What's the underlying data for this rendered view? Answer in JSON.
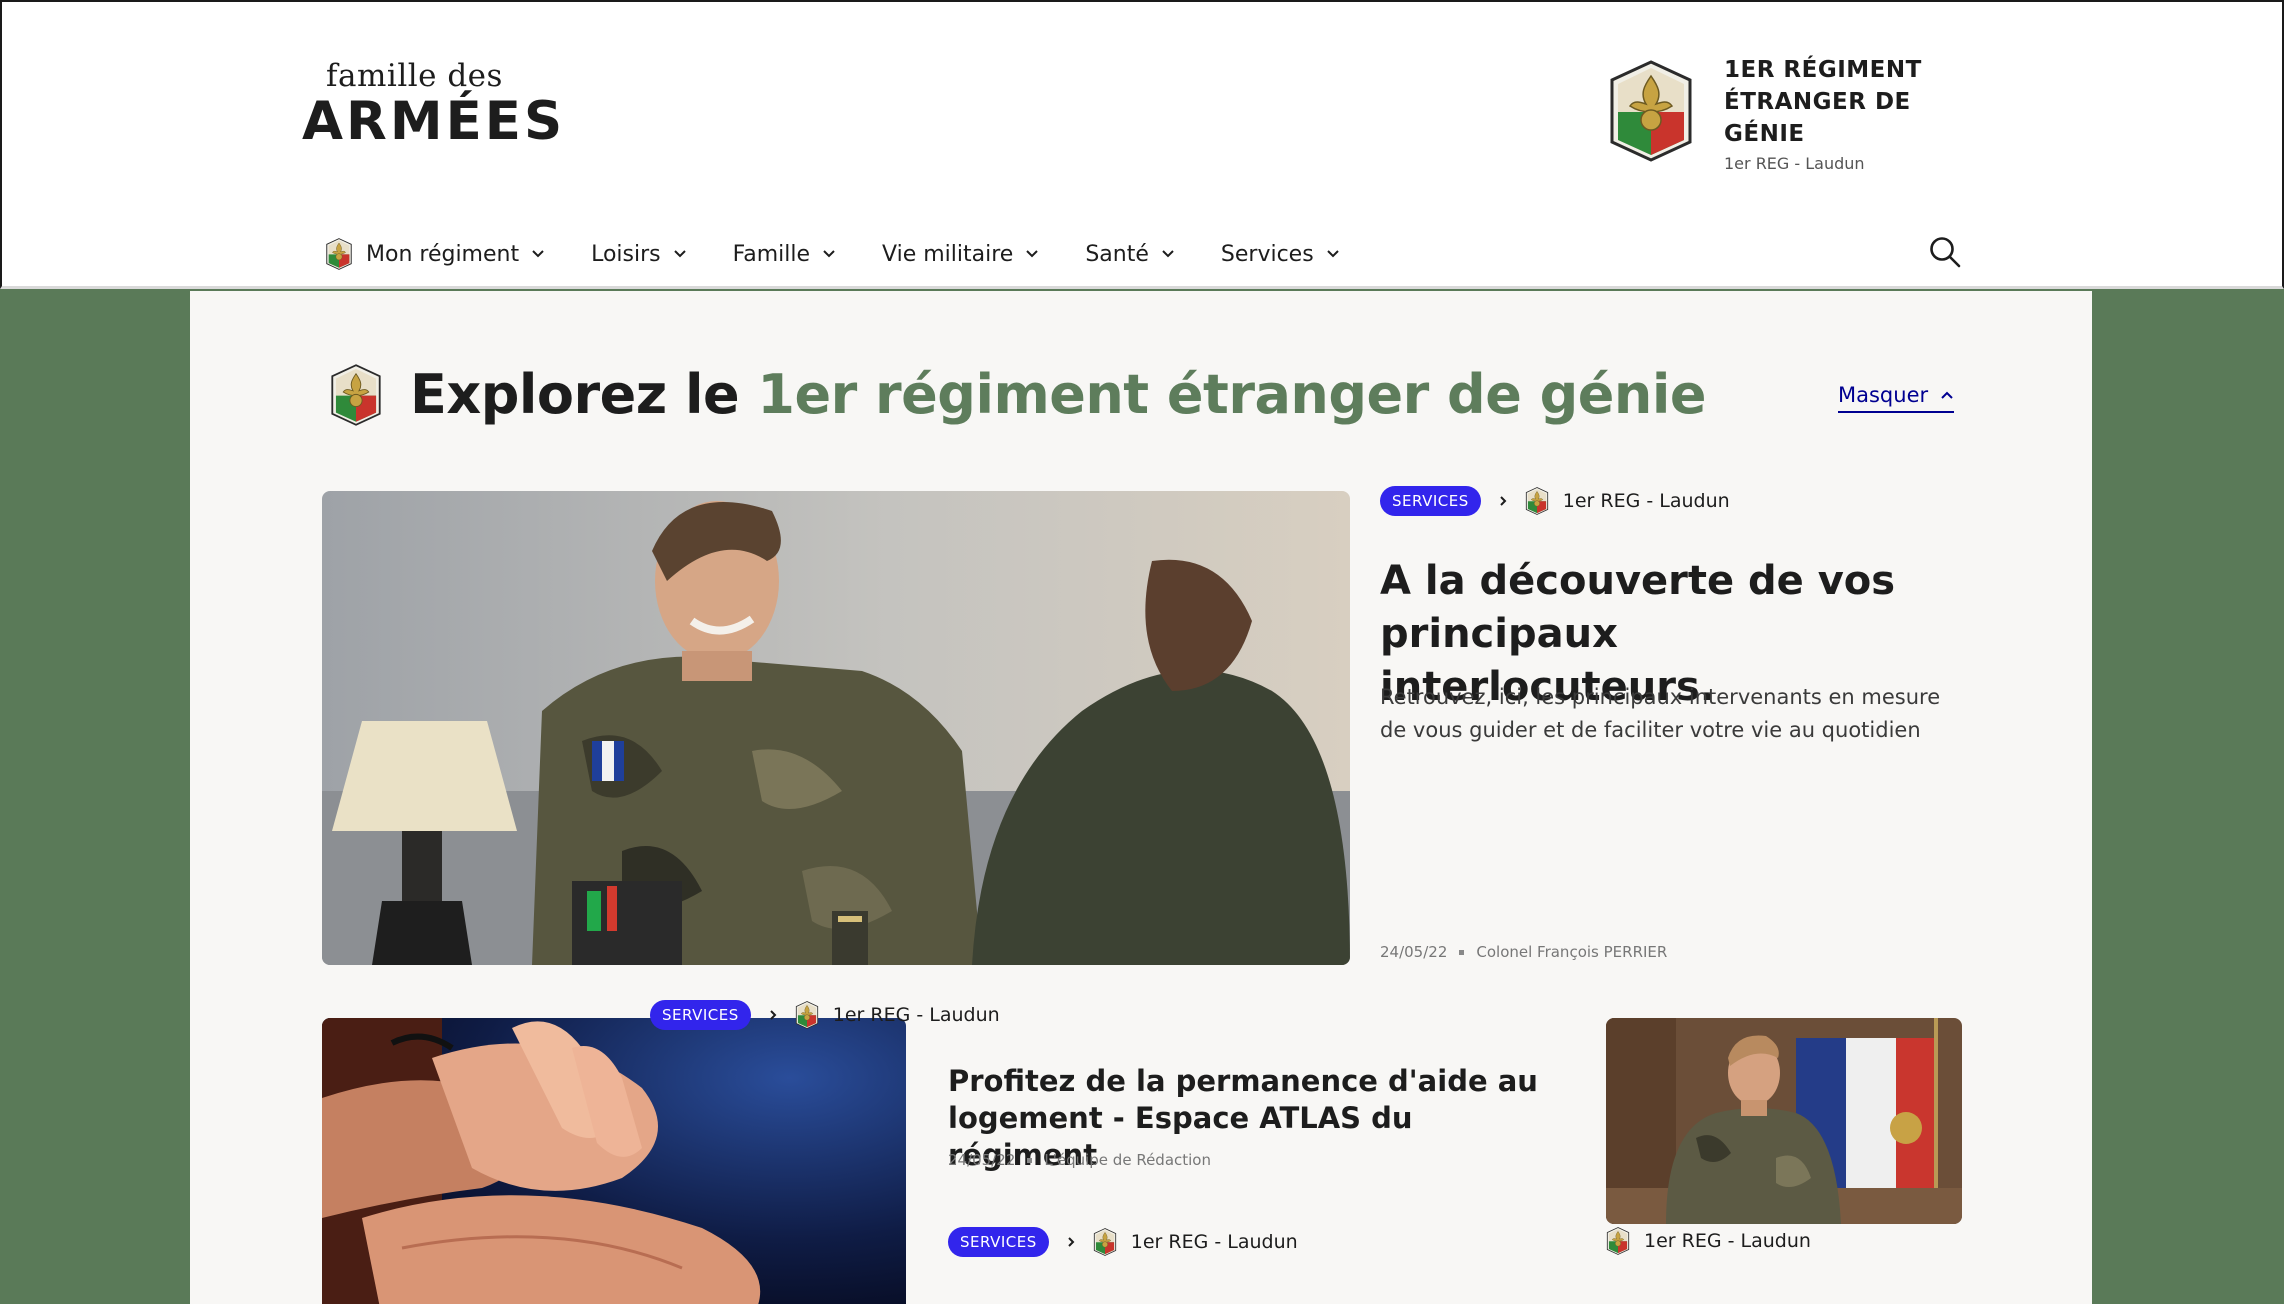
{
  "brand": {
    "logo_top": "famille des",
    "logo_main": "ARMÉES"
  },
  "regiment": {
    "name": "1ER RÉGIMENT ÉTRANGER DE GÉNIE",
    "sub": "1er REG - Laudun"
  },
  "nav": {
    "items": [
      {
        "label": "Mon régiment"
      },
      {
        "label": "Loisirs"
      },
      {
        "label": "Famille"
      },
      {
        "label": "Vie militaire"
      },
      {
        "label": "Santé"
      },
      {
        "label": "Services"
      }
    ]
  },
  "explore": {
    "prefix": "Explorez le ",
    "accent": "1er régiment étranger de génie",
    "hide_label": "Masquer"
  },
  "featured": {
    "tag": "SERVICES",
    "source": "1er REG - Laudun",
    "title": "A la découverte de vos principaux interlocuteurs.",
    "description": "Retrouvez, ici, les principaux intervenants en mesure de vous guider et de faciliter votre vie au quotidien",
    "date": "24/05/22",
    "author": "Colonel François PERRIER"
  },
  "articles": [
    {
      "tag": "SERVICES",
      "source": "1er REG - Laudun",
      "title": "Profitez de la permanence d'aide au logement - Espace ATLAS du régiment",
      "date": "24/05/22",
      "author": "L'équipe de Rédaction"
    },
    {
      "tag": "SERVICES",
      "source": "1er REG - Laudun"
    },
    {
      "source": "1er REG - Laudun"
    }
  ],
  "colors": {
    "accent_green": "#5e7d5c",
    "background_green": "#5a7a58",
    "tag_blue": "#3225ec",
    "link_blue": "#000091"
  }
}
